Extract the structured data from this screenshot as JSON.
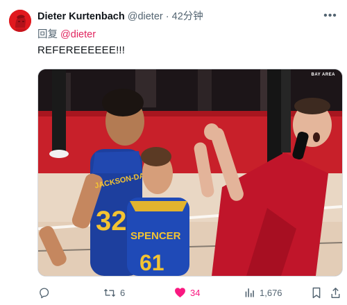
{
  "tweet": {
    "display_name": "Dieter Kurtenbach",
    "handle": "@dieter",
    "separator": "·",
    "time": "42分钟",
    "reply_prefix": "回复",
    "reply_to": "@dieter",
    "text": "REFEREEEEEE!!!",
    "media": {
      "watermark": "BAY AREA",
      "jersey_left_name": "JACKSON-DAVIS",
      "jersey_left_number": "32",
      "jersey_center_name": "SPENCER",
      "jersey_center_number": "61"
    },
    "actions": {
      "reply_icon": "reply-icon",
      "retweet_icon": "retweet-icon",
      "retweet_count": "6",
      "like_icon": "heart-icon",
      "like_count": "34",
      "views_icon": "views-icon",
      "views_count": "1,676",
      "bookmark_icon": "bookmark-icon",
      "share_icon": "share-icon"
    }
  },
  "colors": {
    "like_accent": "#f91880",
    "reply_handle": "#e0245e",
    "muted_text": "#536471",
    "avatar_bg": "#e0191f"
  }
}
